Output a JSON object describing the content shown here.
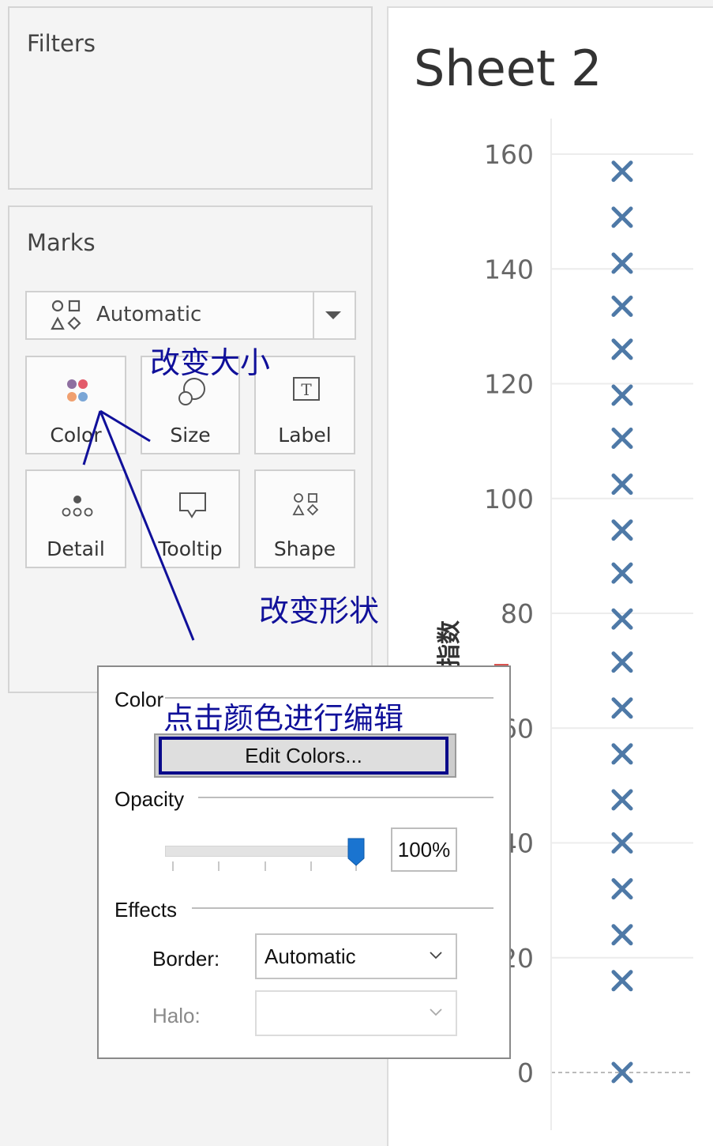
{
  "filters": {
    "title": "Filters"
  },
  "marks": {
    "title": "Marks",
    "mark_type": {
      "value": "Automatic",
      "icon": "shapes-icon"
    },
    "cards": [
      {
        "label": "Color",
        "icon": "color-dots-icon"
      },
      {
        "label": "Size",
        "icon": "size-circles-icon"
      },
      {
        "label": "Label",
        "icon": "label-t-icon"
      },
      {
        "label": "Detail",
        "icon": "detail-dots-icon"
      },
      {
        "label": "Tooltip",
        "icon": "tooltip-bubble-icon"
      },
      {
        "label": "Shape",
        "icon": "shapes-icon"
      }
    ]
  },
  "sheet": {
    "title": "Sheet 2"
  },
  "chart_data": {
    "type": "scatter",
    "ylabel": "总指数",
    "ylim": [
      0,
      160
    ],
    "y_ticks": [
      "0",
      "20",
      "40",
      "60",
      "80",
      "100",
      "120",
      "140",
      "160"
    ],
    "marker": "x",
    "marker_color": "#4e79a7",
    "grid": true,
    "values": [
      157,
      149,
      141,
      133.5,
      126,
      118,
      110.5,
      102.5,
      94.5,
      87,
      79,
      71.5,
      63.5,
      55.5,
      47.5,
      40,
      32,
      24,
      16,
      0
    ]
  },
  "popup": {
    "color_label": "Color",
    "edit_colors": "Edit Colors...",
    "opacity_label": "Opacity",
    "opacity_value": "100%",
    "opacity_level": 1.0,
    "effects_label": "Effects",
    "border_label": "Border:",
    "border_value": "Automatic",
    "halo_label": "Halo:",
    "halo_value": ""
  },
  "annotations": {
    "size_note": "改变大小",
    "shape_note": "改变形状",
    "color_note": "点击颜色进行编辑",
    "color": "#10109a"
  }
}
